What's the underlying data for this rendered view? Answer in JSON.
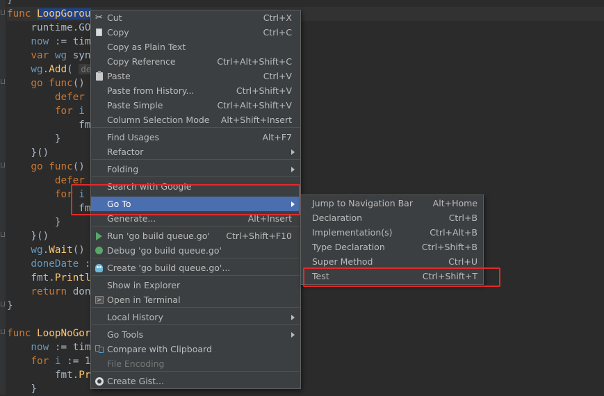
{
  "editor": {
    "lines": [
      {
        "id": "l0",
        "html": "<span class=\"dim\">}</span>"
      },
      {
        "id": "l1",
        "parts": [
          [
            "kw",
            "func "
          ],
          [
            "nm hl",
            "LoopGorou"
          ]
        ]
      },
      {
        "id": "l2",
        "parts": [
          [
            "dim",
            "    runtime.GO"
          ]
        ]
      },
      {
        "id": "l3",
        "parts": [
          [
            "var",
            "    now"
          ],
          [
            "dim",
            " := tim"
          ]
        ]
      },
      {
        "id": "l4",
        "parts": [
          [
            "kw",
            "    var "
          ],
          [
            "var",
            "wg"
          ],
          [
            "dim",
            " syn"
          ]
        ]
      },
      {
        "id": "l5",
        "parts": [
          [
            "var",
            "    wg"
          ],
          [
            "dim",
            "."
          ],
          [
            "fn",
            "Add"
          ],
          [
            "dim",
            "( "
          ],
          [
            "hint",
            "de"
          ]
        ]
      },
      {
        "id": "l6",
        "parts": [
          [
            "kw",
            "    go func"
          ],
          [
            "dim",
            "() "
          ]
        ]
      },
      {
        "id": "l7",
        "parts": [
          [
            "kw",
            "        defer"
          ]
        ]
      },
      {
        "id": "l8",
        "parts": [
          [
            "kw",
            "        for "
          ],
          [
            "var",
            "i"
          ]
        ]
      },
      {
        "id": "l9",
        "parts": [
          [
            "dim",
            "            fm"
          ]
        ]
      },
      {
        "id": "l10",
        "parts": [
          [
            "dim",
            "        }"
          ]
        ]
      },
      {
        "id": "l11",
        "parts": [
          [
            "dim",
            "    }()"
          ]
        ]
      },
      {
        "id": "l12",
        "parts": [
          [
            "kw",
            "    go func"
          ],
          [
            "dim",
            "() "
          ]
        ]
      },
      {
        "id": "l13",
        "parts": [
          [
            "kw",
            "        defer"
          ]
        ]
      },
      {
        "id": "l14",
        "parts": [
          [
            "kw",
            "        for "
          ],
          [
            "var",
            "i"
          ]
        ]
      },
      {
        "id": "l15",
        "parts": [
          [
            "dim",
            "            fm"
          ]
        ]
      },
      {
        "id": "l16",
        "parts": [
          [
            "dim",
            "        }"
          ]
        ]
      },
      {
        "id": "l17",
        "parts": [
          [
            "dim",
            "    }()"
          ]
        ]
      },
      {
        "id": "l18",
        "parts": [
          [
            "var",
            "    wg"
          ],
          [
            "dim",
            "."
          ],
          [
            "fn",
            "Wait"
          ],
          [
            "dim",
            "() "
          ]
        ]
      },
      {
        "id": "l19",
        "parts": [
          [
            "var",
            "    doneDate"
          ],
          [
            "dim",
            " :"
          ]
        ]
      },
      {
        "id": "l20",
        "parts": [
          [
            "dim",
            "    fmt."
          ],
          [
            "fn",
            "Printl"
          ]
        ]
      },
      {
        "id": "l21",
        "parts": [
          [
            "kw",
            "    return "
          ],
          [
            "dim",
            "don"
          ]
        ]
      },
      {
        "id": "l22",
        "parts": [
          [
            "dim",
            "}"
          ]
        ]
      },
      {
        "id": "l23",
        "parts": [
          [
            "dim",
            ""
          ]
        ]
      },
      {
        "id": "l24",
        "parts": [
          [
            "kw",
            "func "
          ],
          [
            "nm",
            "LoopNoGor"
          ]
        ]
      },
      {
        "id": "l25",
        "parts": [
          [
            "var",
            "    now"
          ],
          [
            "dim",
            " := tim"
          ]
        ]
      },
      {
        "id": "l26",
        "parts": [
          [
            "kw",
            "    for "
          ],
          [
            "var",
            "i"
          ],
          [
            "dim",
            " := 1"
          ]
        ]
      },
      {
        "id": "l27",
        "parts": [
          [
            "dim",
            "        fmt."
          ],
          [
            "fn",
            "Pr"
          ]
        ]
      },
      {
        "id": "l28",
        "parts": [
          [
            "dim",
            "    }"
          ]
        ]
      }
    ]
  },
  "context_menu": {
    "items": [
      {
        "id": "cut",
        "label": "Cut",
        "shortcut": "Ctrl+X",
        "icon": "scissors-icon"
      },
      {
        "id": "copy",
        "label": "Copy",
        "shortcut": "Ctrl+C",
        "icon": "copy-icon"
      },
      {
        "id": "copy-plain",
        "label": "Copy as Plain Text",
        "shortcut": ""
      },
      {
        "id": "copy-ref",
        "label": "Copy Reference",
        "shortcut": "Ctrl+Alt+Shift+C"
      },
      {
        "id": "paste",
        "label": "Paste",
        "shortcut": "Ctrl+V",
        "icon": "paste-icon"
      },
      {
        "id": "paste-history",
        "label": "Paste from History...",
        "shortcut": "Ctrl+Shift+V"
      },
      {
        "id": "paste-simple",
        "label": "Paste Simple",
        "shortcut": "Ctrl+Alt+Shift+V"
      },
      {
        "id": "column-mode",
        "label": "Column Selection Mode",
        "shortcut": "Alt+Shift+Insert"
      },
      {
        "id": "find-usages",
        "label": "Find Usages",
        "shortcut": "Alt+F7"
      },
      {
        "id": "refactor",
        "label": "Refactor",
        "submenu": true
      },
      {
        "id": "folding",
        "label": "Folding",
        "submenu": true
      },
      {
        "id": "search-google",
        "label": "Search with Google",
        "shortcut": ""
      },
      {
        "id": "go-to",
        "label": "Go To",
        "submenu": true,
        "active": true
      },
      {
        "id": "generate",
        "label": "Generate...",
        "shortcut": "Alt+Insert"
      },
      {
        "id": "run",
        "label": "Run 'go build queue.go'",
        "shortcut": "Ctrl+Shift+F10",
        "icon": "run-icon"
      },
      {
        "id": "debug",
        "label": "Debug 'go build queue.go'",
        "shortcut": "",
        "icon": "debug-icon"
      },
      {
        "id": "create",
        "label": "Create 'go build queue.go'...",
        "shortcut": "",
        "icon": "gopher-icon"
      },
      {
        "id": "show-explorer",
        "label": "Show in Explorer",
        "shortcut": ""
      },
      {
        "id": "open-terminal",
        "label": "Open in Terminal",
        "shortcut": "",
        "icon": "terminal-icon"
      },
      {
        "id": "local-history",
        "label": "Local History",
        "submenu": true
      },
      {
        "id": "go-tools",
        "label": "Go Tools",
        "submenu": true
      },
      {
        "id": "compare-clipboard",
        "label": "Compare with Clipboard",
        "shortcut": "",
        "icon": "compare-icon"
      },
      {
        "id": "file-encoding",
        "label": "File Encoding",
        "shortcut": "",
        "disabled": true
      },
      {
        "id": "create-gist",
        "label": "Create Gist...",
        "shortcut": "",
        "icon": "gist-icon"
      }
    ]
  },
  "goto_submenu": {
    "items": [
      {
        "id": "jump-nav",
        "label": "Jump to Navigation Bar",
        "shortcut": "Alt+Home"
      },
      {
        "id": "declaration",
        "label": "Declaration",
        "shortcut": "Ctrl+B"
      },
      {
        "id": "implementation",
        "label": "Implementation(s)",
        "shortcut": "Ctrl+Alt+B"
      },
      {
        "id": "type-decl",
        "label": "Type Declaration",
        "shortcut": "Ctrl+Shift+B"
      },
      {
        "id": "super-method",
        "label": "Super Method",
        "shortcut": "Ctrl+U"
      },
      {
        "id": "test",
        "label": "Test",
        "shortcut": "Ctrl+Shift+T"
      }
    ]
  }
}
